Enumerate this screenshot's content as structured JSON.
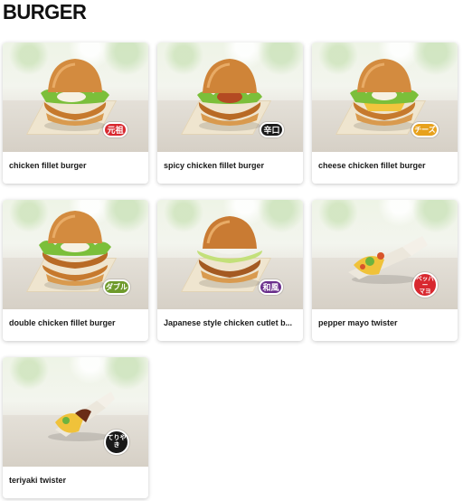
{
  "page": {
    "title": "BURGER"
  },
  "items": [
    {
      "name": "chicken fillet burger",
      "badge": "元祖",
      "badge_color": "#d8282f"
    },
    {
      "name": "spicy chicken fillet burger",
      "badge": "辛口",
      "badge_color": "#1a1a1a"
    },
    {
      "name": "cheese chicken fillet burger",
      "badge": "チーズ",
      "badge_color": "#e7a11c"
    },
    {
      "name": "double chicken fillet burger",
      "badge": "ダブル",
      "badge_color": "#6e9a2b"
    },
    {
      "name": "Japanese style chicken cutlet b...",
      "badge": "和風",
      "badge_color": "#6a2f8c"
    },
    {
      "name": "pepper mayo twister",
      "badge": "ペッパーマヨ",
      "badge_line1": "ペッパー",
      "badge_line2": "マヨ",
      "badge_color": "#d8282f"
    },
    {
      "name": "teriyaki twister",
      "badge": "てりやき",
      "badge_color": "#1a1a1a"
    }
  ]
}
